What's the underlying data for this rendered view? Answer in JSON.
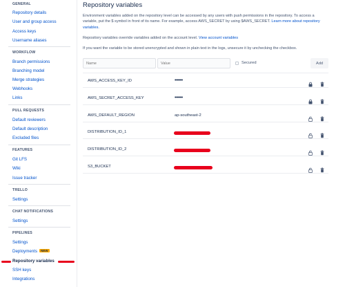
{
  "sidebar": {
    "sections": [
      {
        "key": "general",
        "heading": "GENERAL",
        "items": [
          "Repository details",
          "User and group access",
          "Access keys",
          "Username aliases"
        ]
      },
      {
        "key": "workflow",
        "heading": "WORKFLOW",
        "items": [
          "Branch permissions",
          "Branching model",
          "Merge strategies",
          "Webhooks",
          "Links"
        ]
      },
      {
        "key": "pull_requests",
        "heading": "PULL REQUESTS",
        "items": [
          "Default reviewers",
          "Default description",
          "Excluded files"
        ]
      },
      {
        "key": "features",
        "heading": "FEATURES",
        "items": [
          "Git LFS",
          "Wiki",
          "Issue tracker"
        ]
      },
      {
        "key": "trello",
        "heading": "TRELLO",
        "items": [
          "Settings"
        ]
      },
      {
        "key": "chat",
        "heading": "CHAT NOTIFICATIONS",
        "items": [
          "Settings"
        ]
      },
      {
        "key": "pipelines",
        "heading": "PIPELINES",
        "items": [
          "Settings",
          "Deployments",
          "Repository variables",
          "SSH keys",
          "Integrations"
        ]
      }
    ],
    "new_badge": "NEW"
  },
  "main": {
    "title": "Repository variables",
    "description": "Environment variables added on the repository level can be accessed by any users with push permissions in the repository. To access a variable, put the $ symbol in front of its name. For example, access AWS_SECRET by using $AWS_SECRET.",
    "learn_more": "Learn more about repository variables.",
    "override_text": "Repository variables override variables added on the account level.",
    "view_account_link": "View account variables",
    "unencrypted_text": "If you want the variable to be stored unencrypted and shown in plain text in the logs, unsecure it by unchecking the checkbox.",
    "name_placeholder": "Name",
    "value_placeholder": "Value",
    "secured_label": "Secured",
    "add_label": "Add",
    "variables": [
      {
        "name": "AWS_ACCESS_KEY_ID",
        "value": "••••••",
        "secured": true,
        "redacted": false
      },
      {
        "name": "AWS_SECRET_ACCESS_KEY",
        "value": "••••••",
        "secured": true,
        "redacted": false
      },
      {
        "name": "AWS_DEFAULT_REGION",
        "value": "ap-southeast-2",
        "secured": false,
        "redacted": false
      },
      {
        "name": "DISTRIBUTION_ID_1",
        "value": "",
        "secured": false,
        "redacted": true
      },
      {
        "name": "DISTRIBUTION_ID_2",
        "value": "",
        "secured": false,
        "redacted": true
      },
      {
        "name": "S3_BUCKET",
        "value": "",
        "secured": false,
        "redacted": true
      }
    ]
  },
  "colors": {
    "link": "#0052cc",
    "annotation_red": "#e8001c",
    "badge": "#ffab00"
  },
  "icons": {
    "secured": "lock-icon",
    "unsecured": "unlock-icon",
    "delete": "trash-icon"
  }
}
